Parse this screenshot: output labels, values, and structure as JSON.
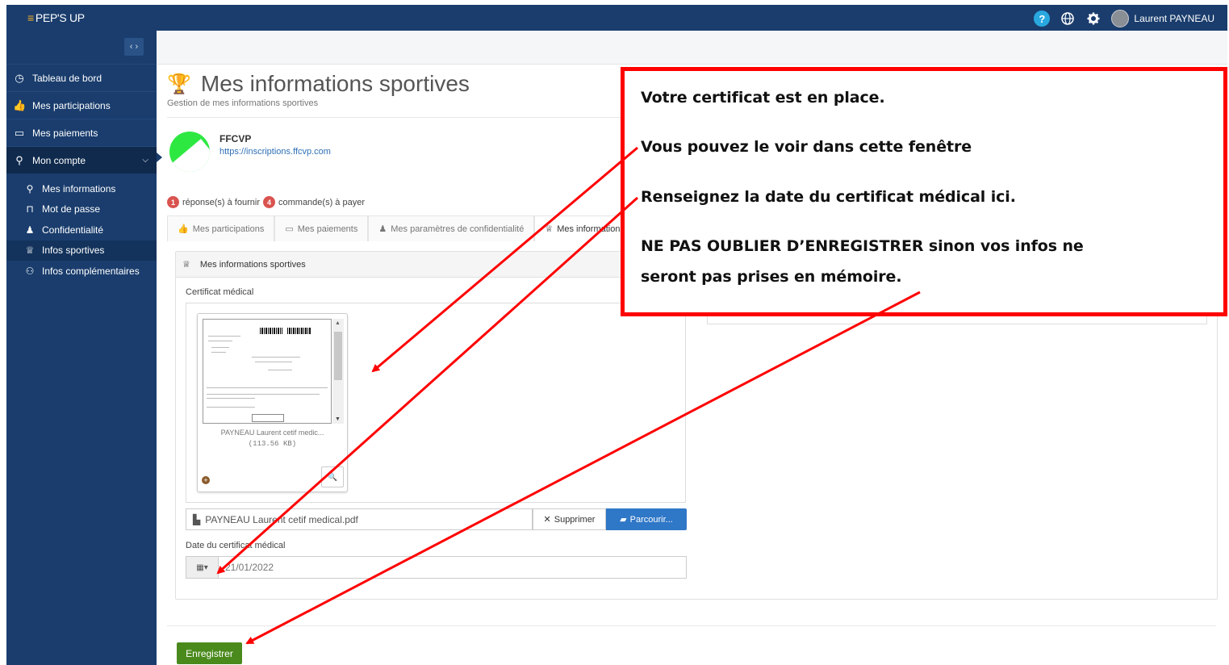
{
  "app": {
    "logo_text": "PEP'S UP",
    "user_name": "Laurent PAYNEAU"
  },
  "sidebar": {
    "items": [
      {
        "label": "Tableau de bord",
        "icon": "dashboard-icon"
      },
      {
        "label": "Mes participations",
        "icon": "thumbs-up-icon"
      },
      {
        "label": "Mes paiements",
        "icon": "credit-card-icon"
      },
      {
        "label": "Mon compte",
        "icon": "user-icon"
      }
    ],
    "sub_items": [
      {
        "label": "Mes informations",
        "icon": "user-icon"
      },
      {
        "label": "Mot de passe",
        "icon": "lock-icon"
      },
      {
        "label": "Confidentialité",
        "icon": "spy-icon"
      },
      {
        "label": "Infos sportives",
        "icon": "trophy-icon"
      },
      {
        "label": "Infos complémentaires",
        "icon": "users-icon"
      }
    ],
    "active_sub_item": "Infos sportives"
  },
  "page": {
    "title": "Mes informations sportives",
    "subtitle": "Gestion de mes informations sportives"
  },
  "organization": {
    "name": "FFCVP",
    "url": "https://inscriptions.ffcvp.com"
  },
  "badges": {
    "responses_count": "1",
    "responses_label": "réponse(s) à fournir",
    "orders_count": "4",
    "orders_label": "commande(s) à payer"
  },
  "tabs": [
    {
      "label": "Mes participations"
    },
    {
      "label": "Mes paiements"
    },
    {
      "label": "Mes paramètres de confidentialité"
    },
    {
      "label": "Mes informations s"
    }
  ],
  "active_tab": "Mes informations s",
  "panel": {
    "title": "Mes informations sportives"
  },
  "form": {
    "certificate_label": "Certificat médical",
    "file_name": "PAYNEAU Laurent cetif medic...",
    "file_size": "(113.56 KB)",
    "file_input_value": "PAYNEAU Laurent cetif medical.pdf",
    "delete_label": "Supprimer",
    "browse_label": "Parcourir...",
    "date_label": "Date du certificat médical",
    "date_value": "21/01/2022"
  },
  "save_label": "Enregistrer",
  "annotation": {
    "line1": "Votre certificat est en place.",
    "line2": "Vous pouvez le voir dans cette fenêtre",
    "line3": "Renseignez la date du certificat médical ici.",
    "line4": "NE PAS OUBLIER D’ENREGISTRER sinon vos infos ne",
    "line5": "seront pas prises en mémoire."
  },
  "colors": {
    "nav_bg": "#1a3d6d",
    "annotation_red": "#ff0000",
    "save_green": "#4a8a1c",
    "browse_blue": "#2f77c7",
    "badge_red": "#d9534f"
  }
}
